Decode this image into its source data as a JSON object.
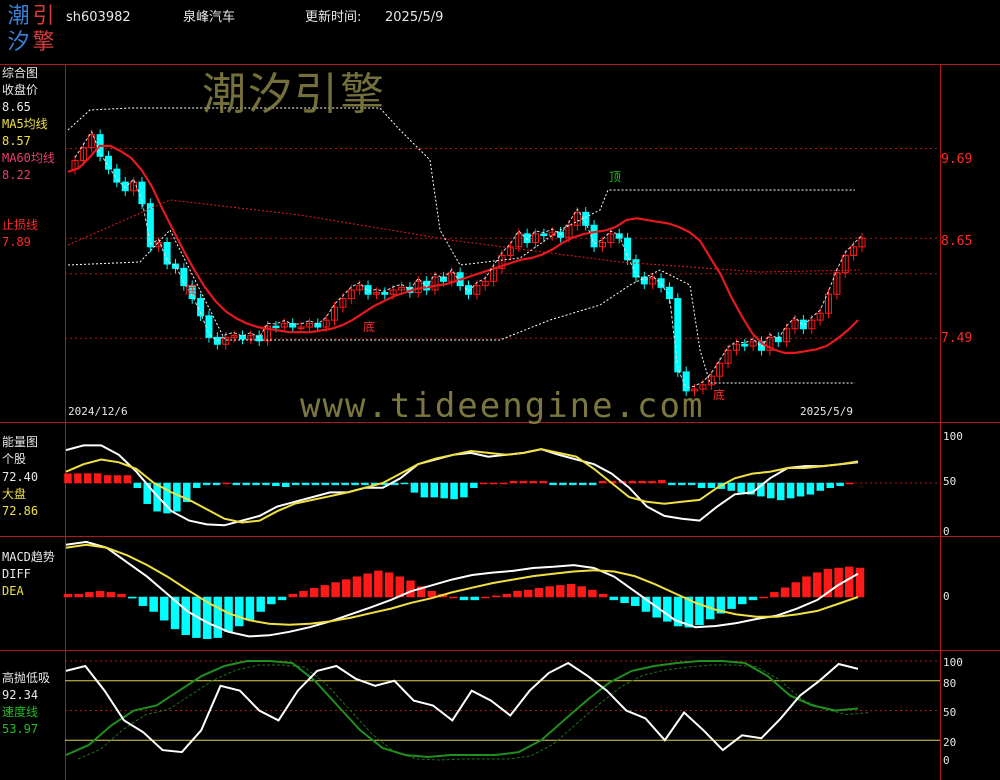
{
  "header": {
    "logo_chars": [
      "潮",
      "引",
      "汐",
      "擎"
    ],
    "code": "sh603982",
    "name": "泉峰汽车",
    "update_label": "更新时间:",
    "update_date": "2025/5/9"
  },
  "watermarks": {
    "brand": "潮汐引擎",
    "url": "www.tideengine.com"
  },
  "colors": {
    "up": "#ff1a1a",
    "down": "#00ffff",
    "ma60": "#e6191f",
    "white": "#ffffff",
    "yellow": "#f0e040",
    "green": "#1f8f1f",
    "grid": "#b01818"
  },
  "panels": {
    "price": {
      "title": "综合图",
      "close_label": "收盘价",
      "close_value": "8.65",
      "ma5_label": "MA5均线",
      "ma5_value": "8.57",
      "ma60_label": "MA60均线",
      "ma60_value": "8.22",
      "stop_label": "止损线",
      "stop_value": "7.89",
      "axis_labels": [
        "9.69",
        "8.65",
        "7.49"
      ],
      "date_start": "2024/12/6",
      "date_end": "2025/5/9",
      "annotations": {
        "top": "顶",
        "bottom": "底"
      }
    },
    "energy": {
      "title": "能量图",
      "stock_label": "个股",
      "stock_value": "72.40",
      "market_label": "大盘",
      "market_value": "72.86",
      "axis_labels": [
        "100",
        "50",
        "0"
      ]
    },
    "macd": {
      "title": "MACD趋势",
      "diff_label": "DIFF",
      "dea_label": "DEA",
      "axis_labels": [
        "0"
      ]
    },
    "highlow": {
      "title": "高抛低吸",
      "value": "92.34",
      "speed_label": "速度线",
      "speed_value": "53.97",
      "axis_labels": [
        "100",
        "80",
        "50",
        "20",
        "0"
      ]
    }
  },
  "chart_data": [
    {
      "type": "candlestick",
      "title": "综合图",
      "dates_range": [
        "2024/12/6",
        "2025/5/9"
      ],
      "yaxis_ticks": [
        9.69,
        8.65,
        7.49
      ],
      "ylim": [
        6.6,
        10.6
      ],
      "closes": [
        9.55,
        9.7,
        9.85,
        9.6,
        9.45,
        9.3,
        9.2,
        9.3,
        9.05,
        8.55,
        8.6,
        8.35,
        8.3,
        8.1,
        7.95,
        7.75,
        7.5,
        7.42,
        7.5,
        7.52,
        7.48,
        7.52,
        7.46,
        7.63,
        7.62,
        7.66,
        7.62,
        7.62,
        7.66,
        7.62,
        7.7,
        7.85,
        7.95,
        8.05,
        8.1,
        8.0,
        8.02,
        8.0,
        8.05,
        8.08,
        8.02,
        8.15,
        8.05,
        8.2,
        8.15,
        8.25,
        8.1,
        8.0,
        8.1,
        8.15,
        8.3,
        8.45,
        8.55,
        8.7,
        8.6,
        8.7,
        8.68,
        8.72,
        8.66,
        8.8,
        8.95,
        8.8,
        8.55,
        8.6,
        8.7,
        8.65,
        8.4,
        8.2,
        8.12,
        8.18,
        8.08,
        7.95,
        7.1,
        6.88,
        6.9,
        6.95,
        7.05,
        7.2,
        7.35,
        7.42,
        7.4,
        7.45,
        7.35,
        7.5,
        7.45,
        7.6,
        7.7,
        7.6,
        7.7,
        7.78,
        8.0,
        8.25,
        8.45,
        8.55,
        8.65
      ],
      "ma60": [
        9.42,
        9.46,
        9.58,
        9.72,
        9.72,
        9.66,
        9.58,
        9.44,
        9.24,
        8.98,
        8.74,
        8.5,
        8.28,
        8.08,
        7.92,
        7.8,
        7.72,
        7.66,
        7.62,
        7.6,
        7.58,
        7.56,
        7.56,
        7.56,
        7.58,
        7.6,
        7.64,
        7.7,
        7.78,
        7.86,
        7.92,
        7.98,
        8.02,
        8.06,
        8.08,
        8.1,
        8.12,
        8.16,
        8.2,
        8.24,
        8.28,
        8.32,
        8.36,
        8.4,
        8.42,
        8.46,
        8.52,
        8.6,
        8.66,
        8.7,
        8.72,
        8.74,
        8.78,
        8.86,
        8.88,
        8.86,
        8.84,
        8.82,
        8.78,
        8.72,
        8.62,
        8.42,
        8.22,
        7.96,
        7.74,
        7.54,
        7.42,
        7.36,
        7.32,
        7.32,
        7.34,
        7.36,
        7.4,
        7.48,
        7.58,
        7.7
      ],
      "stop_line": 7.89,
      "annotations": [
        {
          "label": "顶",
          "value": 9.0
        },
        {
          "label": "底",
          "value": 7.1
        },
        {
          "label": "底",
          "value": 6.9
        }
      ]
    },
    {
      "type": "bar+line",
      "title": "能量图",
      "ylim": [
        0,
        100
      ],
      "yaxis_ticks": [
        100,
        50,
        0
      ],
      "series": [
        {
          "name": "个股",
          "values": [
            85,
            90,
            90,
            80,
            62,
            40,
            20,
            10,
            6,
            5,
            10,
            15,
            25,
            30,
            35,
            40,
            40,
            45,
            45,
            55,
            70,
            75,
            80,
            82,
            78,
            80,
            82,
            86,
            80,
            75,
            70,
            60,
            45,
            25,
            15,
            12,
            10,
            25,
            38,
            40,
            55,
            66,
            68,
            68,
            70,
            72
          ]
        },
        {
          "name": "大盘",
          "values": [
            62,
            70,
            75,
            72,
            65,
            50,
            40,
            32,
            22,
            12,
            8,
            10,
            20,
            28,
            32,
            36,
            40,
            45,
            50,
            60,
            70,
            76,
            80,
            84,
            82,
            80,
            82,
            86,
            82,
            78,
            65,
            50,
            35,
            30,
            28,
            30,
            32,
            45,
            55,
            60,
            62,
            66,
            66,
            68,
            70,
            73
          ]
        }
      ],
      "bars": [
        10,
        10,
        10,
        10,
        8,
        8,
        8,
        -5,
        -22,
        -30,
        -32,
        -30,
        -20,
        -5,
        -2,
        -2,
        0,
        -2,
        -2,
        -2,
        -2,
        -3,
        -4,
        -2,
        -2,
        -2,
        -2,
        -2,
        -2,
        -2,
        -2,
        -2,
        -2,
        -2,
        -1,
        -10,
        -15,
        -15,
        -16,
        -17,
        -15,
        -5,
        0,
        0,
        0,
        2,
        2,
        2,
        2,
        -2,
        -2,
        -2,
        -2,
        -2,
        2,
        2,
        2,
        2,
        2,
        2,
        3,
        -2,
        -2,
        -2,
        -5,
        -5,
        -6,
        -8,
        -10,
        -12,
        -14,
        -16,
        -18,
        -16,
        -14,
        -12,
        -8,
        -5,
        -3,
        0
      ]
    },
    {
      "type": "macd",
      "title": "MACD趋势",
      "yaxis_ticks": [
        0
      ],
      "series": [
        {
          "name": "DIFF",
          "values": [
            0.9,
            0.95,
            0.85,
            0.6,
            0.35,
            0.05,
            -0.25,
            -0.45,
            -0.6,
            -0.68,
            -0.66,
            -0.6,
            -0.52,
            -0.42,
            -0.3,
            -0.18,
            -0.05,
            0.1,
            0.2,
            0.3,
            0.38,
            0.42,
            0.45,
            0.5,
            0.52,
            0.55,
            0.5,
            0.35,
            0.1,
            -0.15,
            -0.4,
            -0.52,
            -0.5,
            -0.45,
            -0.38,
            -0.32,
            -0.2,
            -0.05,
            0.2,
            0.4
          ]
        },
        {
          "name": "DEA",
          "values": [
            0.85,
            0.9,
            0.85,
            0.72,
            0.55,
            0.35,
            0.12,
            -0.1,
            -0.28,
            -0.4,
            -0.46,
            -0.48,
            -0.46,
            -0.42,
            -0.36,
            -0.28,
            -0.2,
            -0.1,
            -0.02,
            0.08,
            0.16,
            0.24,
            0.3,
            0.36,
            0.4,
            0.44,
            0.46,
            0.44,
            0.36,
            0.22,
            0.06,
            -0.1,
            -0.22,
            -0.3,
            -0.34,
            -0.34,
            -0.3,
            -0.24,
            -0.12,
            0.0
          ]
        }
      ],
      "bars": [
        0.05,
        0.05,
        0.08,
        0.1,
        0.08,
        0.05,
        -0.02,
        -0.15,
        -0.25,
        -0.4,
        -0.55,
        -0.65,
        -0.7,
        -0.72,
        -0.7,
        -0.6,
        -0.5,
        -0.4,
        -0.25,
        -0.12,
        -0.05,
        0.05,
        0.1,
        0.15,
        0.2,
        0.25,
        0.3,
        0.35,
        0.4,
        0.45,
        0.42,
        0.35,
        0.28,
        0.18,
        0.1,
        0.05,
        0.0,
        -0.05,
        -0.05,
        0.0,
        0.02,
        0.05,
        0.1,
        0.12,
        0.15,
        0.18,
        0.2,
        0.22,
        0.18,
        0.12,
        0.05,
        -0.05,
        -0.1,
        -0.15,
        -0.25,
        -0.35,
        -0.42,
        -0.5,
        -0.52,
        -0.48,
        -0.38,
        -0.28,
        -0.2,
        -0.12,
        -0.05,
        0.0,
        0.08,
        0.16,
        0.25,
        0.35,
        0.42,
        0.48,
        0.5,
        0.52,
        0.5
      ]
    },
    {
      "type": "line",
      "title": "高抛低吸",
      "ylim": [
        0,
        100
      ],
      "yaxis_ticks": [
        100,
        80,
        50,
        20,
        0
      ],
      "series": [
        {
          "name": "高抛低吸",
          "values": [
            90,
            95,
            70,
            40,
            28,
            10,
            8,
            30,
            75,
            70,
            50,
            40,
            70,
            90,
            95,
            82,
            75,
            80,
            60,
            55,
            40,
            70,
            60,
            45,
            70,
            88,
            98,
            85,
            70,
            50,
            42,
            20,
            48,
            30,
            10,
            25,
            22,
            42,
            65,
            80,
            97,
            92
          ]
        },
        {
          "name": "速度线",
          "values": [
            5,
            15,
            35,
            50,
            55,
            70,
            85,
            95,
            100,
            100,
            98,
            80,
            55,
            30,
            12,
            5,
            3,
            5,
            5,
            5,
            8,
            20,
            40,
            60,
            78,
            90,
            95,
            98,
            100,
            100,
            98,
            85,
            65,
            55,
            50,
            52
          ]
        }
      ]
    }
  ]
}
